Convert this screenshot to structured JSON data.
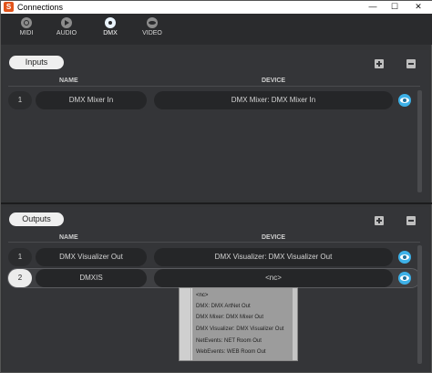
{
  "window": {
    "title": "Connections",
    "min": "—",
    "max": "☐",
    "close": "✕"
  },
  "tabs": [
    {
      "label": "MIDI",
      "icon": "midi-port-icon"
    },
    {
      "label": "AUDIO",
      "icon": "play-icon"
    },
    {
      "label": "DMX",
      "icon": "dmx-icon",
      "active": true
    },
    {
      "label": "VIDEO",
      "icon": "eye-icon"
    }
  ],
  "inputs": {
    "title": "Inputs",
    "col_name": "NAME",
    "col_device": "DEVICE",
    "rows": [
      {
        "index": "1",
        "name": "DMX Mixer In",
        "device": "DMX Mixer: DMX Mixer In"
      }
    ]
  },
  "outputs": {
    "title": "Outputs",
    "col_name": "NAME",
    "col_device": "DEVICE",
    "rows": [
      {
        "index": "1",
        "name": "DMX Visualizer Out",
        "device": "DMX Visualizer: DMX Visualizer Out"
      },
      {
        "index": "2",
        "name": "DMXIS",
        "device": "<nc>"
      }
    ]
  },
  "device_dropdown": {
    "options": [
      "<nc>",
      "DMX: DMX ArtNet Out",
      "DMX Mixer: DMX Mixer Out",
      "DMX Visualizer: DMX Visualizer Out",
      "NetEvents: NET Room Out",
      "WebEvents: WEB Room Out"
    ]
  },
  "colors": {
    "accent_eye": "#3db1e8",
    "background": "#333436"
  }
}
